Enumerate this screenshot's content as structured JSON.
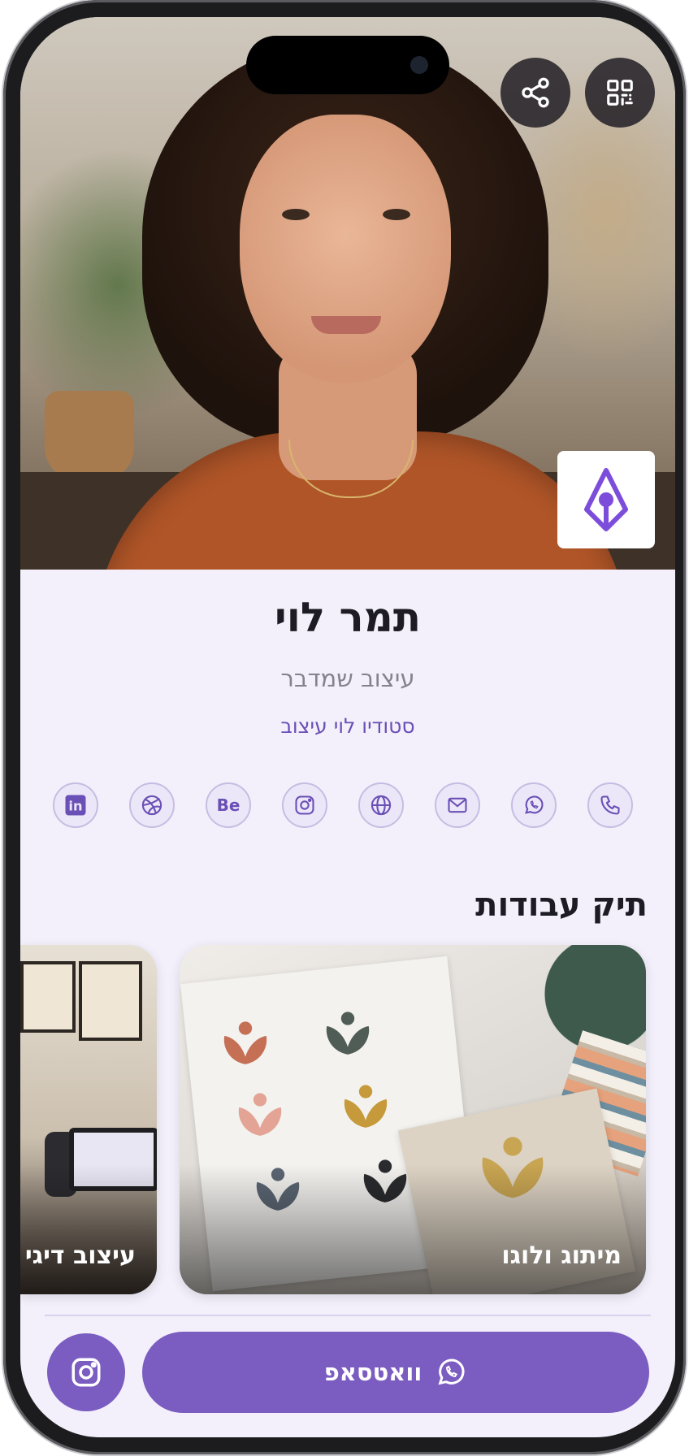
{
  "hero": {
    "share_icon": "share-icon",
    "qr_icon": "qr-code-icon",
    "brand_logo_icon": "pen-nib-icon"
  },
  "profile": {
    "name": "תמר לוי",
    "title": "עיצוב שמדבר",
    "company": "סטודיו לוי עיצוב"
  },
  "contacts": [
    {
      "icon": "phone-icon"
    },
    {
      "icon": "whatsapp-icon"
    },
    {
      "icon": "email-icon"
    },
    {
      "icon": "globe-icon"
    },
    {
      "icon": "instagram-icon"
    },
    {
      "icon": "behance-icon",
      "label": "Be"
    },
    {
      "icon": "dribbble-icon"
    },
    {
      "icon": "linkedin-icon",
      "label": "in"
    }
  ],
  "portfolio": {
    "title": "תיק עבודות",
    "items": [
      {
        "label": "מיתוג ולוגו"
      },
      {
        "label": "עיצוב דיגי"
      }
    ]
  },
  "actions": {
    "whatsapp_label": "וואטסאפ",
    "accent_color": "#7b5cc0"
  }
}
